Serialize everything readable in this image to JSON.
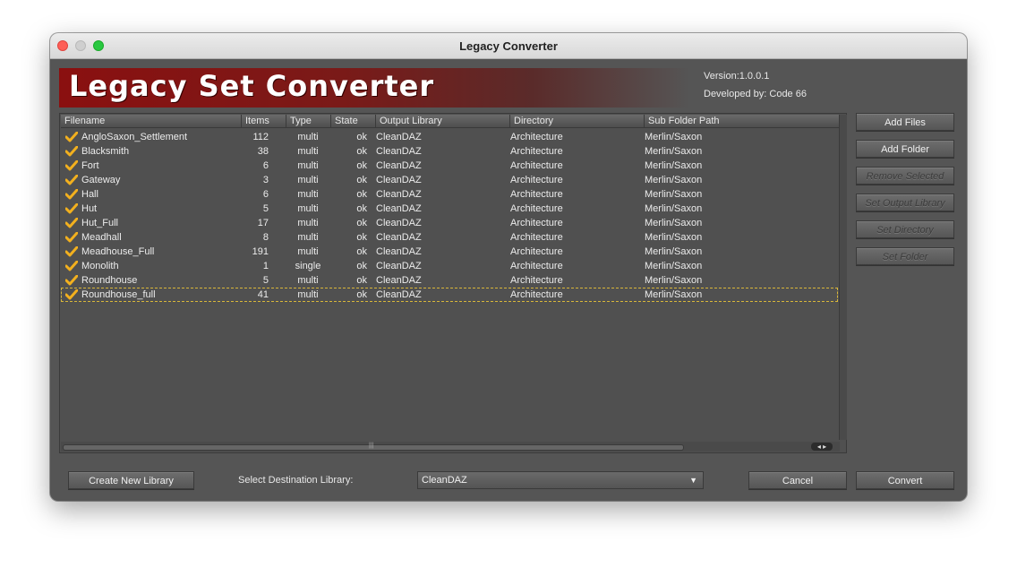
{
  "window": {
    "title": "Legacy Converter"
  },
  "header": {
    "banner_title": "Legacy Set Converter",
    "version": "Version:1.0.0.1",
    "developer": "Developed by: Code 66"
  },
  "table": {
    "columns": [
      "Filename",
      "Items",
      "Type",
      "State",
      "Output Library",
      "Directory",
      "Sub Folder Path"
    ],
    "rows": [
      {
        "filename": "AngloSaxon_Settlement",
        "items": "112",
        "type": "multi",
        "state": "ok",
        "output": "CleanDAZ",
        "directory": "Architecture",
        "subfolder": "Merlin/Saxon"
      },
      {
        "filename": "Blacksmith",
        "items": "38",
        "type": "multi",
        "state": "ok",
        "output": "CleanDAZ",
        "directory": "Architecture",
        "subfolder": "Merlin/Saxon"
      },
      {
        "filename": "Fort",
        "items": "6",
        "type": "multi",
        "state": "ok",
        "output": "CleanDAZ",
        "directory": "Architecture",
        "subfolder": "Merlin/Saxon"
      },
      {
        "filename": "Gateway",
        "items": "3",
        "type": "multi",
        "state": "ok",
        "output": "CleanDAZ",
        "directory": "Architecture",
        "subfolder": "Merlin/Saxon"
      },
      {
        "filename": "Hall",
        "items": "6",
        "type": "multi",
        "state": "ok",
        "output": "CleanDAZ",
        "directory": "Architecture",
        "subfolder": "Merlin/Saxon"
      },
      {
        "filename": "Hut",
        "items": "5",
        "type": "multi",
        "state": "ok",
        "output": "CleanDAZ",
        "directory": "Architecture",
        "subfolder": "Merlin/Saxon"
      },
      {
        "filename": "Hut_Full",
        "items": "17",
        "type": "multi",
        "state": "ok",
        "output": "CleanDAZ",
        "directory": "Architecture",
        "subfolder": "Merlin/Saxon"
      },
      {
        "filename": "Meadhall",
        "items": "8",
        "type": "multi",
        "state": "ok",
        "output": "CleanDAZ",
        "directory": "Architecture",
        "subfolder": "Merlin/Saxon"
      },
      {
        "filename": "Meadhouse_Full",
        "items": "191",
        "type": "multi",
        "state": "ok",
        "output": "CleanDAZ",
        "directory": "Architecture",
        "subfolder": "Merlin/Saxon"
      },
      {
        "filename": "Monolith",
        "items": "1",
        "type": "single",
        "state": "ok",
        "output": "CleanDAZ",
        "directory": "Architecture",
        "subfolder": "Merlin/Saxon"
      },
      {
        "filename": "Roundhouse",
        "items": "5",
        "type": "multi",
        "state": "ok",
        "output": "CleanDAZ",
        "directory": "Architecture",
        "subfolder": "Merlin/Saxon"
      },
      {
        "filename": "Roundhouse_full",
        "items": "41",
        "type": "multi",
        "state": "ok",
        "output": "CleanDAZ",
        "directory": "Architecture",
        "subfolder": "Merlin/Saxon"
      }
    ]
  },
  "side_buttons": {
    "add_files": "Add Files",
    "add_folder": "Add Folder",
    "remove_selected": "Remove Selected",
    "set_output_library": "Set Output Library",
    "set_directory": "Set Directory",
    "set_folder": "Set Folder"
  },
  "footer": {
    "create_library": "Create New Library",
    "destination_label": "Select Destination Library:",
    "destination_value": "CleanDAZ",
    "cancel": "Cancel",
    "convert": "Convert"
  },
  "colors": {
    "checkmark": "#f2b01e",
    "banner": "#8a1010",
    "selection_outline": "#d8b63a"
  },
  "icons": {
    "checkbox": "checkmark-icon",
    "dropdown": "chevron-down-icon"
  }
}
